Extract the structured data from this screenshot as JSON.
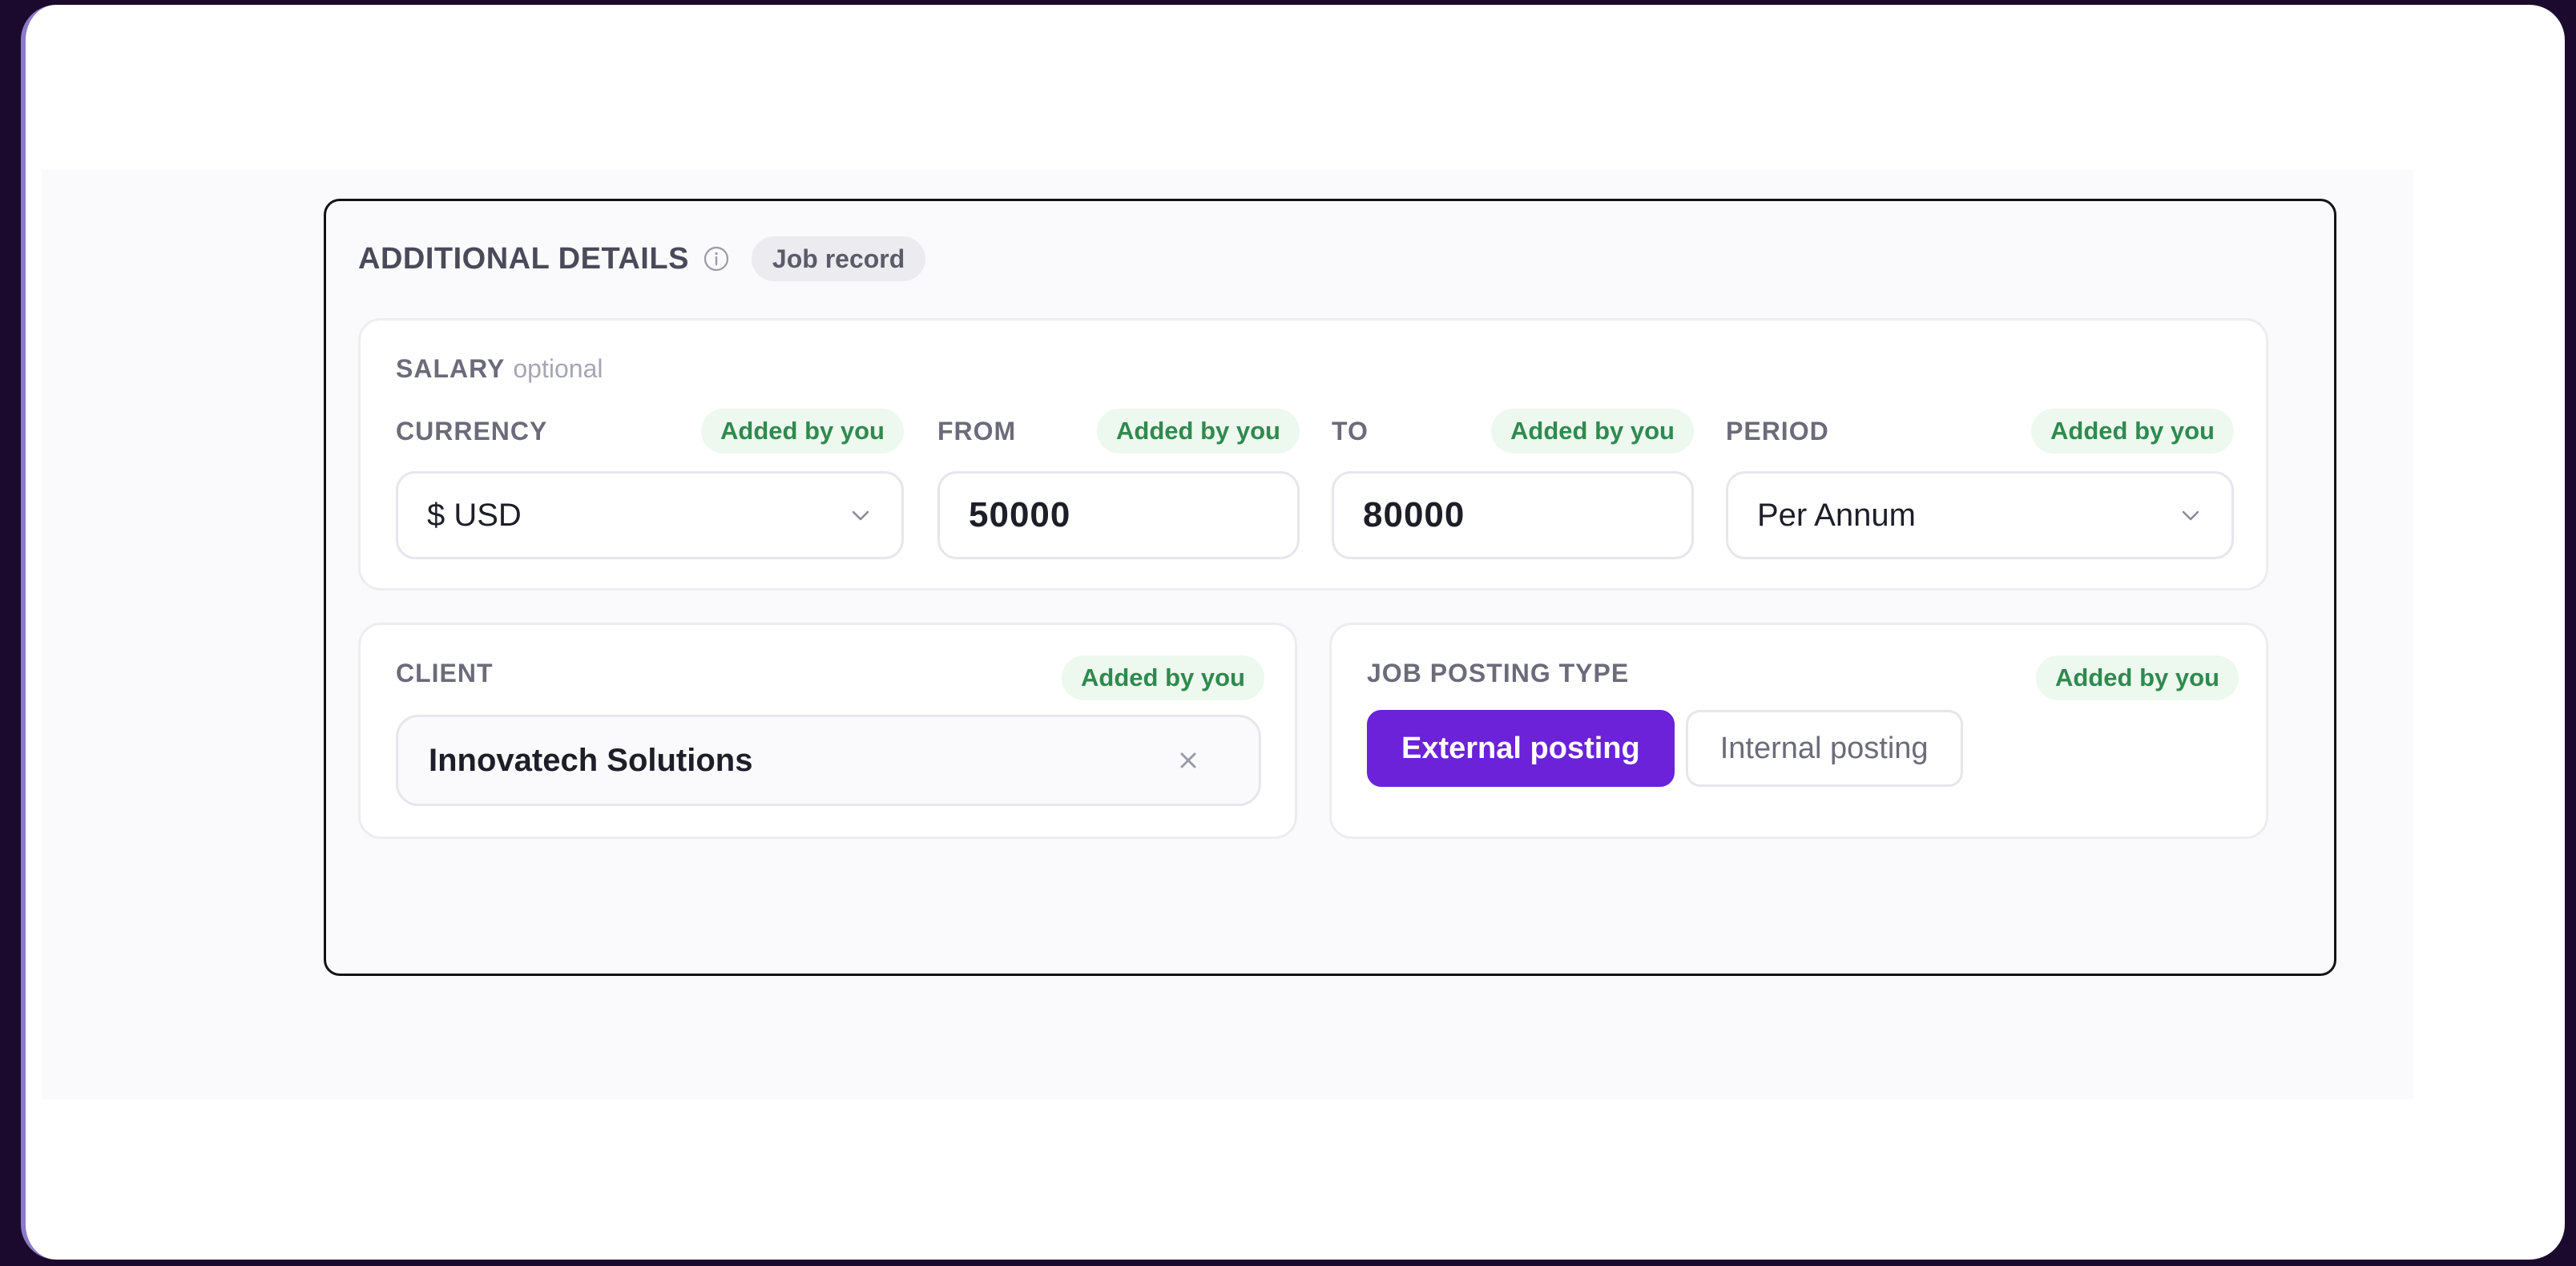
{
  "header": {
    "title": "ADDITIONAL DETAILS",
    "info_icon": "info-icon",
    "chip": "Job record"
  },
  "salary": {
    "title": "SALARY",
    "optional": "optional",
    "fields": [
      {
        "label": "CURRENCY",
        "badge": "Added by you",
        "value": "$ USD",
        "kind": "select"
      },
      {
        "label": "FROM",
        "badge": "Added by you",
        "value": "50000",
        "kind": "number"
      },
      {
        "label": "TO",
        "badge": "Added by you",
        "value": "80000",
        "kind": "number"
      },
      {
        "label": "PERIOD",
        "badge": "Added by you",
        "value": "Per Annum",
        "kind": "select"
      }
    ]
  },
  "client": {
    "label": "CLIENT",
    "badge": "Added by you",
    "value": "Innovatech Solutions",
    "clear_icon": "close-icon"
  },
  "job_posting_type": {
    "label": "JOB POSTING TYPE",
    "badge": "Added by you",
    "options": [
      {
        "label": "External posting",
        "selected": true
      },
      {
        "label": "Internal posting",
        "selected": false
      }
    ]
  },
  "colors": {
    "accent": "#6b22d9",
    "badge_text": "#2f8a4e",
    "badge_bg": "#edf8ef"
  }
}
